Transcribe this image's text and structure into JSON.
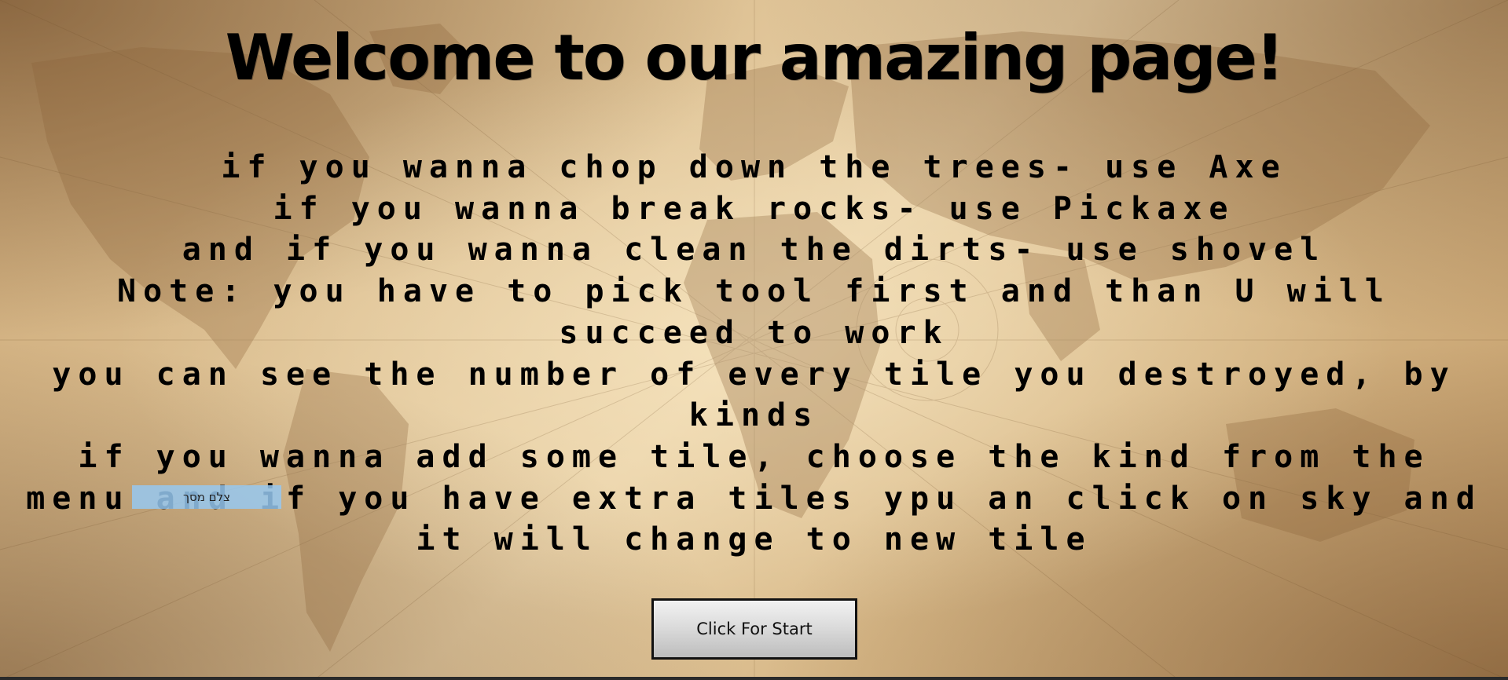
{
  "page": {
    "title": "Welcome to our amazing page!",
    "instructions": [
      "if you wanna chop down the trees- use Axe",
      "if you wanna break rocks- use Pickaxe",
      "and if you wanna clean the dirts- use shovel",
      "Note: you have to pick tool first and than U will succeed to work",
      "you can see the number of every tile you destroyed, by kinds",
      "if you wanna add some tile, choose the kind from the menu and if you have extra tiles ypu an click on sky and it will change to new tile"
    ],
    "start_button_label": "Click For Start"
  },
  "overlay": {
    "selection_tooltip": "צלם מסך"
  },
  "colors": {
    "text": "#000000",
    "parchment_light": "#e8d0a6",
    "parchment_dark": "#8a6238",
    "tooltip": "#96c8f0"
  }
}
